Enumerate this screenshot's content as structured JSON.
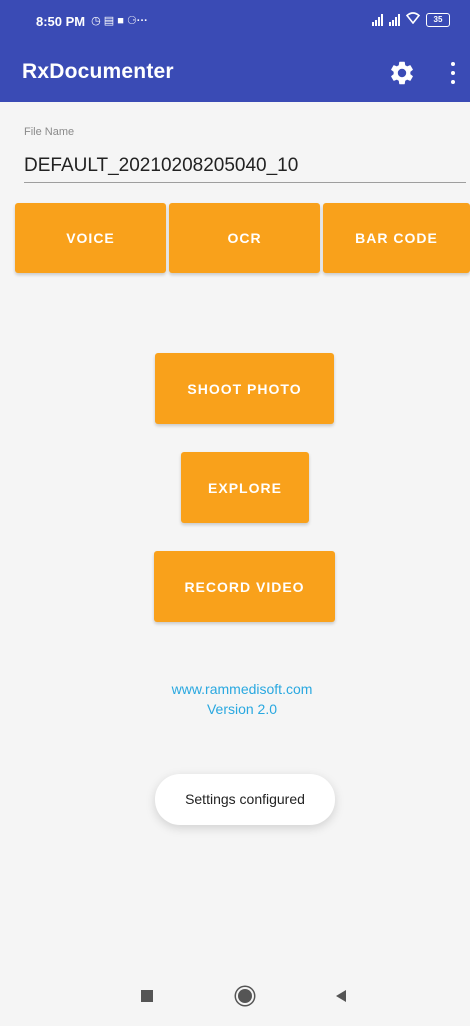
{
  "status_bar": {
    "time": "8:50 PM",
    "notification_icons": "◷ ▤ ■ ⚆···",
    "battery": "35"
  },
  "toolbar": {
    "title": "RxDocumenter",
    "settings_icon": "gear-icon",
    "overflow_icon": "more-vert-icon",
    "bar_color": "#3a4bb5"
  },
  "file_name": {
    "label": "File Name",
    "value": "DEFAULT_20210208205040_10"
  },
  "capture_buttons": {
    "voice": "VOICE",
    "ocr": "OCR",
    "bar_code": "BAR CODE"
  },
  "actions": {
    "shoot_photo": "SHOOT PHOTO",
    "explore": "EXPLORE",
    "record_video": "RECORD VIDEO"
  },
  "footer": {
    "website": "www.rammedisoft.com",
    "version": "Version 2.0"
  },
  "toast": {
    "message": "Settings configured"
  },
  "nav_bar": {
    "recents_icon": "recents-square-icon",
    "home_icon": "home-circle-icon",
    "back_icon": "back-triangle-icon"
  },
  "colors": {
    "accent": "#f9a11b",
    "link": "#29a8e0",
    "background": "#f5f5f5"
  }
}
